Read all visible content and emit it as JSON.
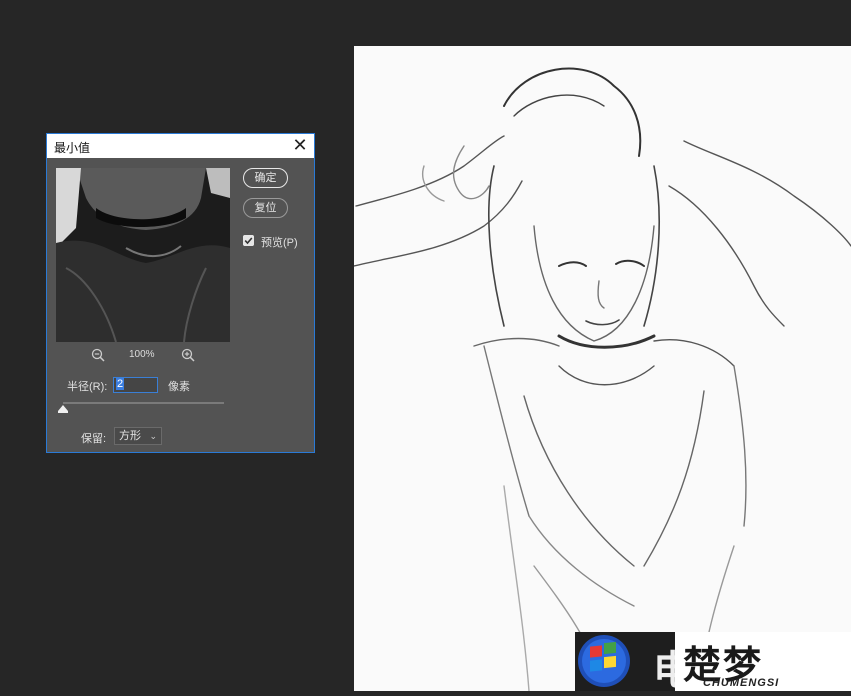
{
  "dialog": {
    "title": "最小值",
    "close_glyph": "✕",
    "ok_label": "确定",
    "reset_label": "复位",
    "preview_label": "预览(P)",
    "preview_checked": true,
    "zoom_level": "100%",
    "radius_label": "半径(R):",
    "radius_value": "2",
    "radius_unit": "像素",
    "preserve_label": "保留:",
    "preserve_value": "方形"
  },
  "watermark": {
    "partial_text": "电",
    "brand_cn": "楚梦",
    "brand_en": "CHUMENGSI"
  },
  "colors": {
    "workspace_bg": "#262626",
    "dialog_bg": "#535353",
    "dialog_border": "#2a7ad6",
    "accent": "#3b7ee0"
  },
  "icons": [
    "close-icon",
    "zoom-out-icon",
    "zoom-in-icon",
    "checkbox-checked-icon",
    "slider-thumb-icon",
    "chevron-down-icon",
    "windows-logo-icon"
  ]
}
